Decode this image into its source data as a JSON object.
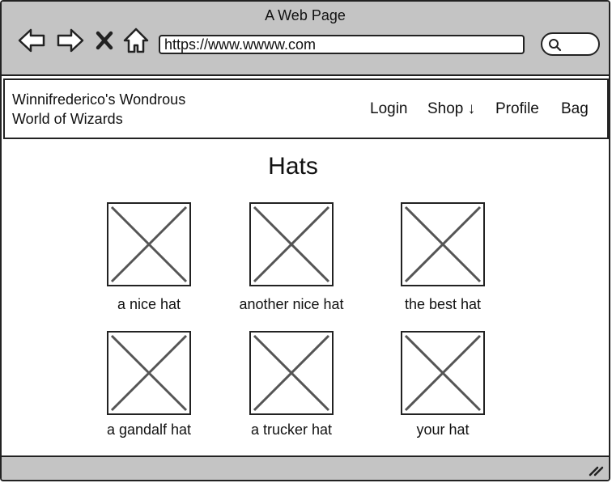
{
  "window": {
    "title": "A Web Page"
  },
  "toolbar": {
    "back_icon": "back-arrow-icon",
    "forward_icon": "forward-arrow-icon",
    "stop_icon": "close-icon",
    "home_icon": "home-icon",
    "url": "https://www.wwww.com",
    "search_icon": "search-icon"
  },
  "site": {
    "name_line1": "Winnifrederico's Wondrous",
    "name_line2": "World of Wizards",
    "nav": {
      "login": "Login",
      "shop": "Shop ↓",
      "profile": "Profile",
      "bag": "Bag"
    }
  },
  "main": {
    "title": "Hats",
    "products": [
      {
        "caption": "a nice hat"
      },
      {
        "caption": "another nice hat"
      },
      {
        "caption": "the best hat"
      },
      {
        "caption": "a gandalf hat"
      },
      {
        "caption": "a trucker hat"
      },
      {
        "caption": "your hat"
      }
    ]
  },
  "colors": {
    "chrome": "#c4c4c4",
    "stroke": "#222222",
    "placeholder_x": "#555555"
  }
}
